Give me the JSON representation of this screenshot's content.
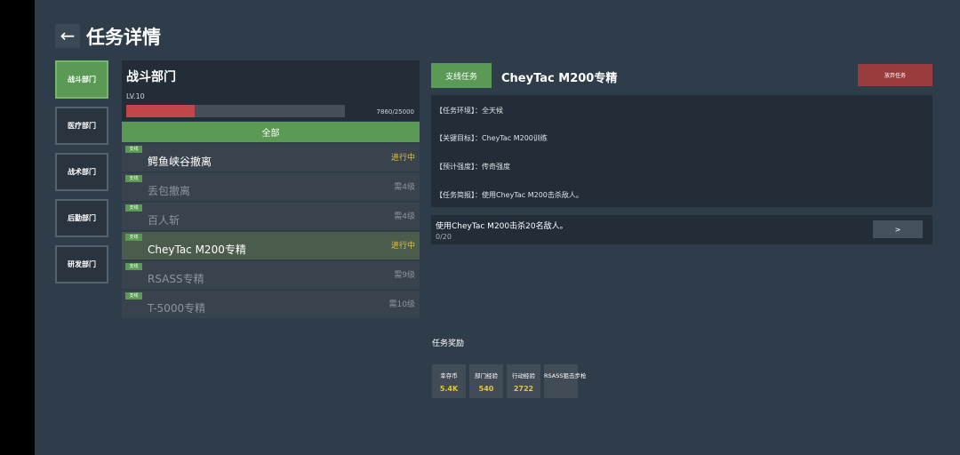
{
  "header": {
    "back_icon": "←",
    "title": "任务详情"
  },
  "departments": [
    {
      "label": "战斗部门",
      "active": true
    },
    {
      "label": "医疗部门",
      "active": false
    },
    {
      "label": "战术部门",
      "active": false
    },
    {
      "label": "后勤部门",
      "active": false
    },
    {
      "label": "研发部门",
      "active": false
    }
  ],
  "dept_panel": {
    "name": "战斗部门",
    "level": "LV.10",
    "xp_text": "7860/25000",
    "xp_fraction": 0.3144,
    "bar_color": "#c0464a"
  },
  "filter": {
    "label": "全部"
  },
  "missions": [
    {
      "tag": "支线",
      "name": "鳄鱼峡谷撤离",
      "status": "进行中",
      "state": "active",
      "selected": false
    },
    {
      "tag": "支线",
      "name": "丢包撤离",
      "status": "需4级",
      "state": "locked",
      "selected": false
    },
    {
      "tag": "支线",
      "name": "百人斩",
      "status": "需4级",
      "state": "locked",
      "selected": false
    },
    {
      "tag": "支线",
      "name": "CheyTac M200专精",
      "status": "进行中",
      "state": "active",
      "selected": true
    },
    {
      "tag": "支线",
      "name": "RSASS专精",
      "status": "需9级",
      "state": "locked",
      "selected": false
    },
    {
      "tag": "支线",
      "name": "T-5000专精",
      "status": "需10级",
      "state": "locked",
      "selected": false
    }
  ],
  "detail": {
    "type_label": "支线任务",
    "title": "CheyTac M200专精",
    "abandon_label": "放弃任务",
    "info_lines": [
      "【任务环境】：全天候",
      "【关键目标】：CheyTac M200训练",
      "【预计强度】：传奇强度",
      "【任务简报】：使用CheyTac M200击杀敌人。"
    ],
    "objective": {
      "text": "使用CheyTac M200击杀20名敌人。",
      "progress": "0/20",
      "go_label": ">"
    }
  },
  "rewards": {
    "title": "任务奖励",
    "items": [
      {
        "label": "幸存币",
        "value": "5.4K"
      },
      {
        "label": "部门经验",
        "value": "540"
      },
      {
        "label": "行动经验",
        "value": "2722"
      },
      {
        "label": "RSASS狙击步枪",
        "value": ""
      }
    ]
  },
  "colors": {
    "accent_green": "#5a9a54",
    "danger_red": "#9a3c3e",
    "highlight_yellow": "#e3c443"
  }
}
